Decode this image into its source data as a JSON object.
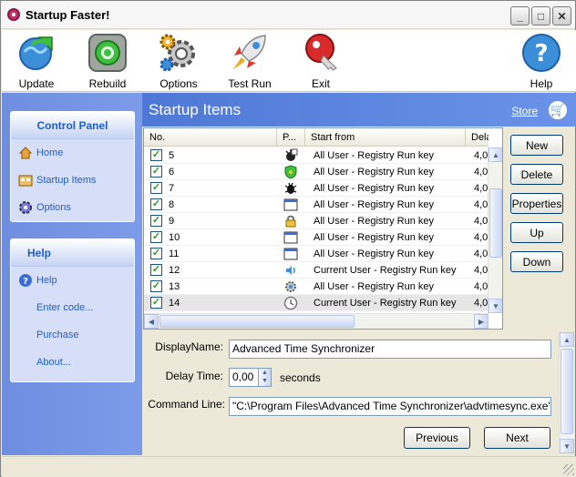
{
  "window": {
    "title": "Startup Faster!",
    "icon": "app-icon"
  },
  "toolbar": {
    "update": {
      "label": "Update",
      "icon": "globe-refresh-icon"
    },
    "rebuild": {
      "label": "Rebuild",
      "icon": "rebuild-icon"
    },
    "options": {
      "label": "Options",
      "icon": "gears-icon"
    },
    "testrun": {
      "label": "Test Run",
      "icon": "rocket-icon"
    },
    "exit": {
      "label": "Exit",
      "icon": "key-icon"
    },
    "help": {
      "label": "Help",
      "icon": "question-icon"
    }
  },
  "sidebar": {
    "control_panel": {
      "title": "Control Panel",
      "items": [
        {
          "label": "Home",
          "icon": "home-icon"
        },
        {
          "label": "Startup Items",
          "icon": "startup-items-icon"
        },
        {
          "label": "Options",
          "icon": "options-icon"
        }
      ]
    },
    "help": {
      "title": "Help",
      "items": [
        {
          "label": "Help",
          "icon": "help-icon"
        },
        {
          "label": "Enter code..."
        },
        {
          "label": "Purchase"
        },
        {
          "label": "About..."
        }
      ]
    }
  },
  "main": {
    "title": "Startup Items",
    "store_label": "Store",
    "columns": [
      "No.",
      "P...",
      "Start from",
      "Delay t"
    ],
    "rows": [
      {
        "no": "5",
        "icon": "virus-icon",
        "start": "All User - Registry Run key",
        "delay": "4,0",
        "checked": true
      },
      {
        "no": "6",
        "icon": "shield-icon",
        "start": "All User - Registry Run key",
        "delay": "4,0",
        "checked": true
      },
      {
        "no": "7",
        "icon": "bug-icon",
        "start": "All User - Registry Run key",
        "delay": "4,0",
        "checked": true
      },
      {
        "no": "8",
        "icon": "window-icon",
        "start": "All User - Registry Run key",
        "delay": "4,0",
        "checked": true
      },
      {
        "no": "9",
        "icon": "lock-icon",
        "start": "All User - Registry Run key",
        "delay": "4,0",
        "checked": true
      },
      {
        "no": "10",
        "icon": "window-icon",
        "start": "All User - Registry Run key",
        "delay": "4,0",
        "checked": true
      },
      {
        "no": "11",
        "icon": "window-icon",
        "start": "All User - Registry Run key",
        "delay": "4,0",
        "checked": true
      },
      {
        "no": "12",
        "icon": "speaker-icon",
        "start": "Current User - Registry Run key",
        "delay": "4,0",
        "checked": true
      },
      {
        "no": "13",
        "icon": "gear-icon",
        "start": "All User - Registry Run key",
        "delay": "4,0",
        "checked": true
      },
      {
        "no": "14",
        "icon": "clock-icon",
        "start": "Current User - Registry Run key",
        "delay": "4,0",
        "checked": true
      }
    ],
    "buttons": {
      "new": "New",
      "delete": "Delete",
      "properties": "Properties",
      "up": "Up",
      "down": "Down"
    }
  },
  "details": {
    "display_name_label": "DisplayName:",
    "display_name_value": "Advanced Time Synchronizer",
    "delay_label": "Delay Time:",
    "delay_value": "0,00",
    "delay_unit": "seconds",
    "command_label": "Command Line:",
    "command_value": "\"C:\\Program Files\\Advanced Time Synchronizer\\advtimesync.exe\" nosh",
    "previous": "Previous",
    "next": "Next"
  },
  "colors": {
    "accent": "#215dc6",
    "header_blue": "#4f78d6",
    "sidebar_blue": "#7c9be8",
    "check_green": "#21a121"
  }
}
